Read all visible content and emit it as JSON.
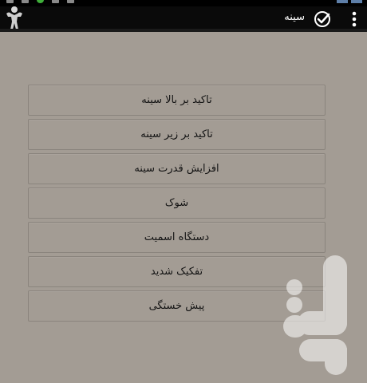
{
  "app_bar": {
    "title": "سینه",
    "logo_icon": "bodybuilder-logo-icon",
    "check_icon": "check-circle-icon",
    "menu_icon": "overflow-menu-icon"
  },
  "menu": {
    "items": [
      {
        "label": "تاکید بر بالا سینه"
      },
      {
        "label": "تاکید بر زیر سینه"
      },
      {
        "label": "افزایش قدرت سینه"
      },
      {
        "label": "شوک"
      },
      {
        "label": "دستگاه اسمیت"
      },
      {
        "label": "تفکیک شدید"
      },
      {
        "label": "پیش خستگی"
      }
    ]
  },
  "colors": {
    "background": "#a39c94",
    "app_bar": "#0a0a0a",
    "text": "#141414",
    "watermark": "#ffffff"
  },
  "watermark_icon": "store-watermark-icon"
}
